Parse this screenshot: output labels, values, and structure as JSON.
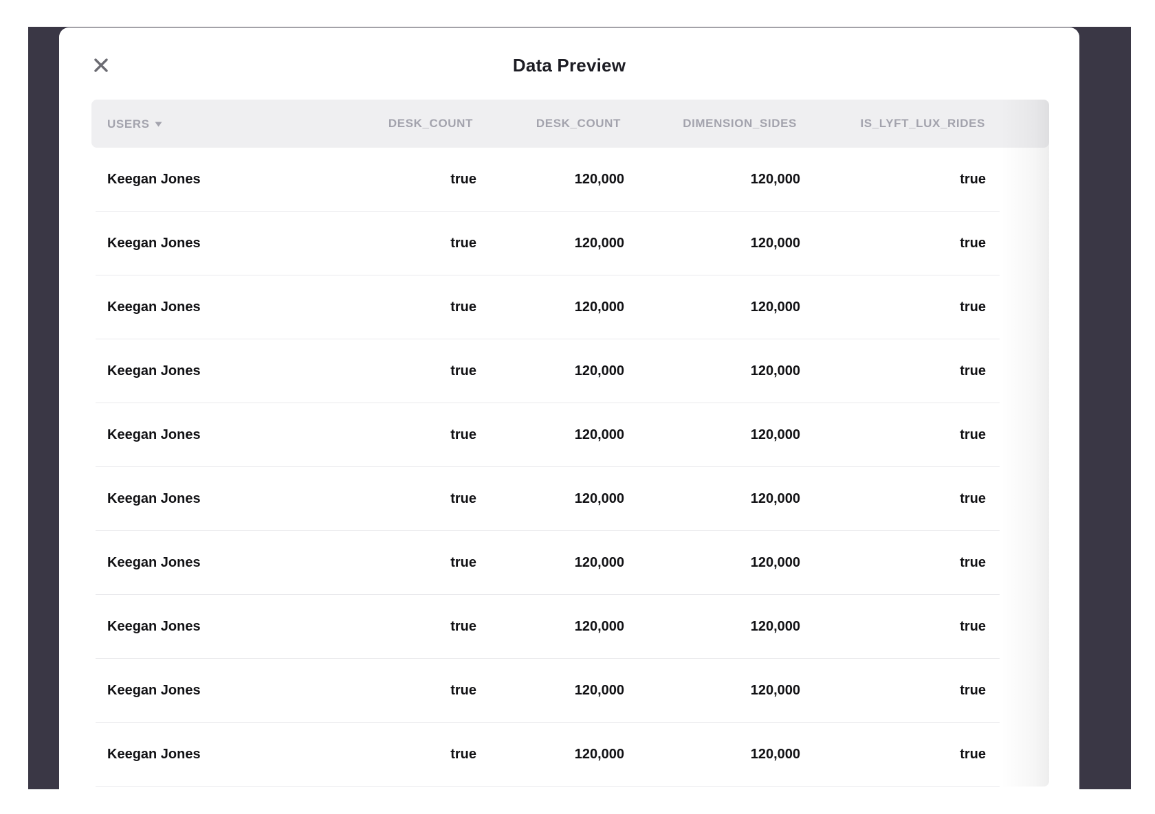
{
  "modal": {
    "title": "Data Preview",
    "close_icon": "close-icon"
  },
  "table": {
    "columns": [
      {
        "label": "USERS",
        "sort_icon": "caret-down-icon"
      },
      {
        "label": "DESK_COUNT"
      },
      {
        "label": "DESK_COUNT"
      },
      {
        "label": "DIMENSION_SIDES"
      },
      {
        "label": "IS_LYFT_LUX_RIDES"
      }
    ],
    "rows": [
      [
        "Keegan Jones",
        "true",
        "120,000",
        "120,000",
        "true"
      ],
      [
        "Keegan Jones",
        "true",
        "120,000",
        "120,000",
        "true"
      ],
      [
        "Keegan Jones",
        "true",
        "120,000",
        "120,000",
        "true"
      ],
      [
        "Keegan Jones",
        "true",
        "120,000",
        "120,000",
        "true"
      ],
      [
        "Keegan Jones",
        "true",
        "120,000",
        "120,000",
        "true"
      ],
      [
        "Keegan Jones",
        "true",
        "120,000",
        "120,000",
        "true"
      ],
      [
        "Keegan Jones",
        "true",
        "120,000",
        "120,000",
        "true"
      ],
      [
        "Keegan Jones",
        "true",
        "120,000",
        "120,000",
        "true"
      ],
      [
        "Keegan Jones",
        "true",
        "120,000",
        "120,000",
        "true"
      ],
      [
        "Keegan Jones",
        "true",
        "120,000",
        "120,000",
        "true"
      ]
    ]
  },
  "colors": {
    "backdrop": "#3a3745",
    "header_bg": "#efeff1",
    "header_text": "#a3a3ad",
    "cell_text": "#111114"
  }
}
